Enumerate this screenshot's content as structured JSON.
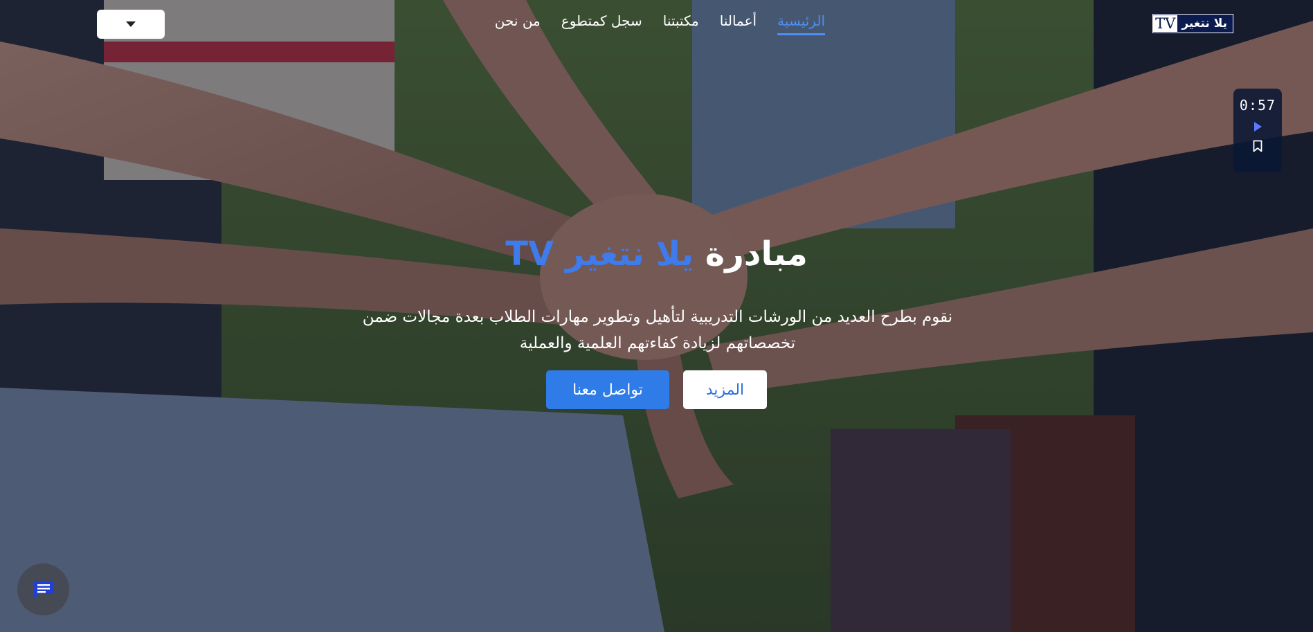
{
  "navbar": {
    "brand": {
      "text_ar": "يلا نتغير",
      "text_tv": "TV"
    },
    "links": [
      {
        "label": "الرئيسية",
        "active": true
      },
      {
        "label": "أعمالنا",
        "active": false
      },
      {
        "label": "مكتبتنا",
        "active": false
      },
      {
        "label": "سجل كمتطوع",
        "active": false
      },
      {
        "label": "من نحن",
        "active": false
      }
    ],
    "language_dropdown": {
      "selected": ""
    }
  },
  "video_widget": {
    "time": "0:57",
    "play_icon": "play-icon",
    "bookmark_icon": "bookmark-icon"
  },
  "hero": {
    "title_prefix": "مبادرة",
    "title_accent": "يلا نتغير TV",
    "description": "نقوم بطرح العديد من الورشات التدريبية لتأهيل وتطوير مهارات الطلاب بعدة مجالات ضمن تخصصاتهم لزيادة كفاءتهم العلمية والعملية",
    "buttons": {
      "more": "المزيد",
      "contact": "تواصل معنا"
    }
  },
  "chat": {
    "icon": "chat-icon"
  },
  "colors": {
    "accent": "#3f7bea",
    "brand_dark": "#0b1b4f",
    "widget_bg": "#0a1834",
    "chat_bg": "#454a55"
  }
}
